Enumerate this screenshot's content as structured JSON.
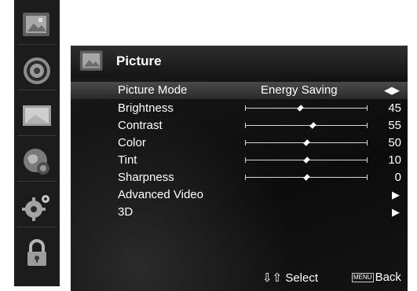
{
  "sidebar": {
    "icons": [
      "picture-icon",
      "sound-icon",
      "screen-icon",
      "globe-icon",
      "settings-icon",
      "lock-icon"
    ]
  },
  "panel": {
    "title": "Picture",
    "title_icon": "picture-icon"
  },
  "rows": [
    {
      "label": "Picture Mode",
      "value": "Energy Saving",
      "type": "select"
    },
    {
      "label": "Brightness",
      "value": "45",
      "level": 0.45,
      "type": "slider"
    },
    {
      "label": "Contrast",
      "value": "55",
      "level": 0.55,
      "type": "slider"
    },
    {
      "label": "Color",
      "value": "50",
      "level": 0.5,
      "type": "slider"
    },
    {
      "label": "Tint",
      "value": "10",
      "level": 0.5,
      "type": "slider"
    },
    {
      "label": "Sharpness",
      "value": "0",
      "level": 0.5,
      "type": "slider"
    },
    {
      "label": "Advanced Video",
      "type": "submenu"
    },
    {
      "label": "3D",
      "type": "submenu"
    }
  ],
  "footer": {
    "nav_arrows": "⇩⇧",
    "select_label": "Select",
    "menu_key": "MENU",
    "back_label": "Back"
  },
  "colors": {
    "selected_row": "#3a3a3a",
    "panel": "#111111",
    "text": "#ffffff"
  }
}
